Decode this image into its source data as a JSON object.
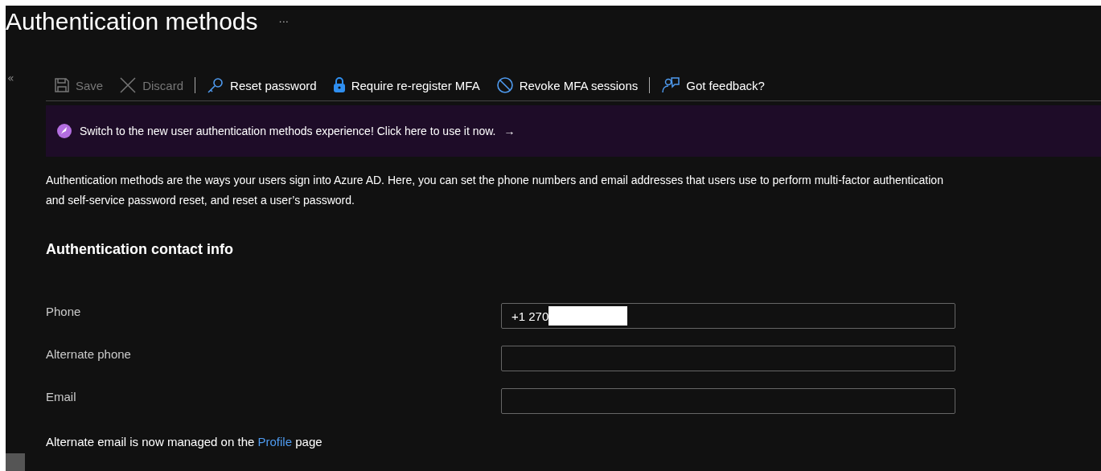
{
  "title": "Authentication methods",
  "more": "···",
  "collapse": "«",
  "toolbar": [
    {
      "kind": "save",
      "label": "Save",
      "disabled": true
    },
    {
      "kind": "discard",
      "label": "Discard",
      "disabled": true
    },
    {
      "kind": "separator"
    },
    {
      "kind": "key",
      "label": "Reset password",
      "disabled": false
    },
    {
      "kind": "lock",
      "label": "Require re-register MFA",
      "disabled": false
    },
    {
      "kind": "block",
      "label": "Revoke MFA sessions",
      "disabled": false
    },
    {
      "kind": "separator"
    },
    {
      "kind": "feedback",
      "label": "Got feedback?",
      "disabled": false
    }
  ],
  "banner": {
    "text": "Switch to the new user authentication methods experience! Click here to use it now.",
    "arrow": "→"
  },
  "description": "Authentication methods are the ways your users sign into Azure AD. Here, you can set the phone numbers and email addresses that users use to perform multi-factor authentication and self-service password reset, and reset a user’s password.",
  "section_title": "Authentication contact info",
  "fields": [
    {
      "label": "Phone",
      "value": "+1 270",
      "redacted": true
    },
    {
      "label": "Alternate phone"
    },
    {
      "label": "Email"
    }
  ],
  "note": {
    "before": "Alternate email is now managed on the",
    "link": "Profile",
    "after": "page"
  }
}
